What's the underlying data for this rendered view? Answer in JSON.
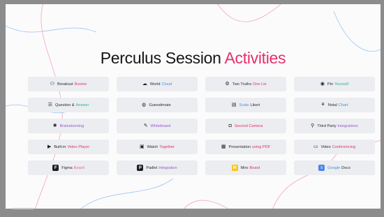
{
  "title": {
    "main": "Perculus Session ",
    "accent": "Activities"
  },
  "colors": {
    "title_accent": "#e6306a",
    "card_bg": "#ebedf0",
    "red": "#e6306a",
    "blue": "#4a90e2",
    "purple": "#9b59d0",
    "green": "#2ab39c",
    "pink": "#ee5fa7"
  },
  "activities": [
    {
      "icon": "breakout-rooms-icon",
      "glyph": "⚇",
      "text": "Breakout",
      "highlight": "Rooms",
      "color": "#e6306a"
    },
    {
      "icon": "world-cloud-icon",
      "glyph": "☁",
      "text": "World",
      "highlight": "Cloud",
      "color": "#4a90e2"
    },
    {
      "icon": "two-truths-icon",
      "glyph": "⚙",
      "text": "Two Truths",
      "highlight": "One Lie",
      "color": "#e6306a"
    },
    {
      "icon": "pin-icon",
      "glyph": "◉",
      "text": "Pin",
      "highlight": "Yourself",
      "color": "#2ab39c"
    },
    {
      "icon": "list-icon",
      "glyph": "☰",
      "text": "Question &",
      "highlight": "Answer",
      "color": "#2ab39c"
    },
    {
      "icon": "guesstimate-icon",
      "glyph": "◍",
      "text": "Guesstimate",
      "highlight": "",
      "color": "#4a90e2"
    },
    {
      "icon": "likert-scale-icon",
      "glyph": "▤",
      "text": "Likert",
      "highlight": "Scale",
      "color": "#4a90e2",
      "highlight_first": true
    },
    {
      "icon": "notes-icon",
      "glyph": "⚘",
      "text": "Notal",
      "highlight": "Chart",
      "color": "#4a90e2"
    },
    {
      "icon": "brainstorming-icon",
      "glyph": "✺",
      "text": "",
      "highlight": "Brainstorming",
      "color": "#9b59d0"
    },
    {
      "icon": "whiteboard-icon",
      "glyph": "✎",
      "text": "",
      "highlight": "Whiteboard",
      "color": "#9b59d0"
    },
    {
      "icon": "second-camera-icon",
      "glyph": "◘",
      "text": "",
      "highlight": "Second Camera",
      "color": "#e6306a"
    },
    {
      "icon": "integrations-icon",
      "glyph": "⚲",
      "text": "Third Party",
      "highlight": "Integrations",
      "color": "#9b59d0"
    },
    {
      "icon": "video-player-icon",
      "glyph": "▶",
      "text": "Built-in",
      "highlight": "Video Player",
      "color": "#e6306a"
    },
    {
      "icon": "watch-together-icon",
      "glyph": "▣",
      "text": "Watch",
      "highlight": "Together",
      "color": "#e6306a"
    },
    {
      "icon": "presentation-icon",
      "glyph": "▦",
      "text": "Presentation",
      "highlight": "using PDF",
      "color": "#e6306a"
    },
    {
      "icon": "video-conferencing-icon",
      "glyph": "▭",
      "text": "Video",
      "highlight": "Conferencing",
      "color": "#e6306a"
    },
    {
      "icon": "figma-logo-icon",
      "tile": "#1e1e1e",
      "tile_glyph": "F",
      "text": "Figma",
      "highlight": "Board",
      "color": "#ee5fa7"
    },
    {
      "icon": "padlet-logo-icon",
      "tile": "#1e1e1e",
      "tile_glyph": "P",
      "text": "Padlet",
      "highlight": "Integration",
      "color": "#9b59d0"
    },
    {
      "icon": "miro-logo-icon",
      "tile": "#f5c518",
      "tile_glyph": "M",
      "text": "Miro",
      "highlight": "Board",
      "color": "#e6306a"
    },
    {
      "icon": "google-docs-icon",
      "tile": "#4a86e8",
      "tile_glyph": "≡",
      "text": "Docs",
      "highlight": "Google",
      "color": "#4a90e2",
      "highlight_first": true
    }
  ]
}
